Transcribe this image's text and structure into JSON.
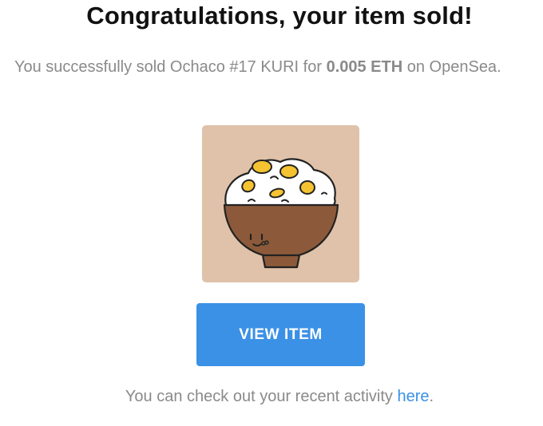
{
  "heading": "Congratulations, your item sold!",
  "sale": {
    "prefix": "You successfully sold Ochaco #17 KURI for ",
    "amount": "0.005 ETH",
    "suffix": " on OpenSea."
  },
  "item_image": {
    "icon": "rice-bowl-with-chestnuts-icon",
    "background_color": "#dfc2a9"
  },
  "view_button": {
    "label": "VIEW ITEM",
    "color": "#3b91e6"
  },
  "activity": {
    "prefix": "You can check out your recent activity ",
    "link_text": "here",
    "suffix": "."
  }
}
